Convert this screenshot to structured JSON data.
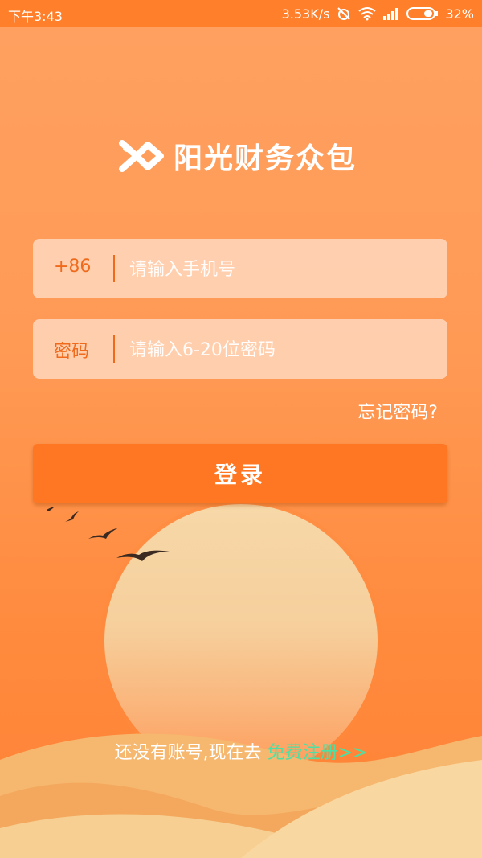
{
  "status_bar": {
    "time": "下午3:43",
    "speed": "3.53K/s",
    "battery": "32%",
    "icons": [
      "mute-alarm-icon",
      "wifi-icon",
      "signal-icon",
      "battery-icon"
    ]
  },
  "logo": {
    "text": "阳光财务众包",
    "icon": "logo-mark-icon"
  },
  "phone_field": {
    "prefix": "+86",
    "placeholder": "请输入手机号"
  },
  "password_field": {
    "label": "密码",
    "placeholder": "请输入6-20位密码"
  },
  "forgot_password": "忘记密码?",
  "login_button": "登录",
  "register": {
    "text": "还没有账号,现在去 ",
    "link": "免费注册>>"
  },
  "colors": {
    "background": "#ff9a55",
    "accent": "#ff7722",
    "link": "#4de0a4",
    "sun": "#f7d5a3"
  }
}
